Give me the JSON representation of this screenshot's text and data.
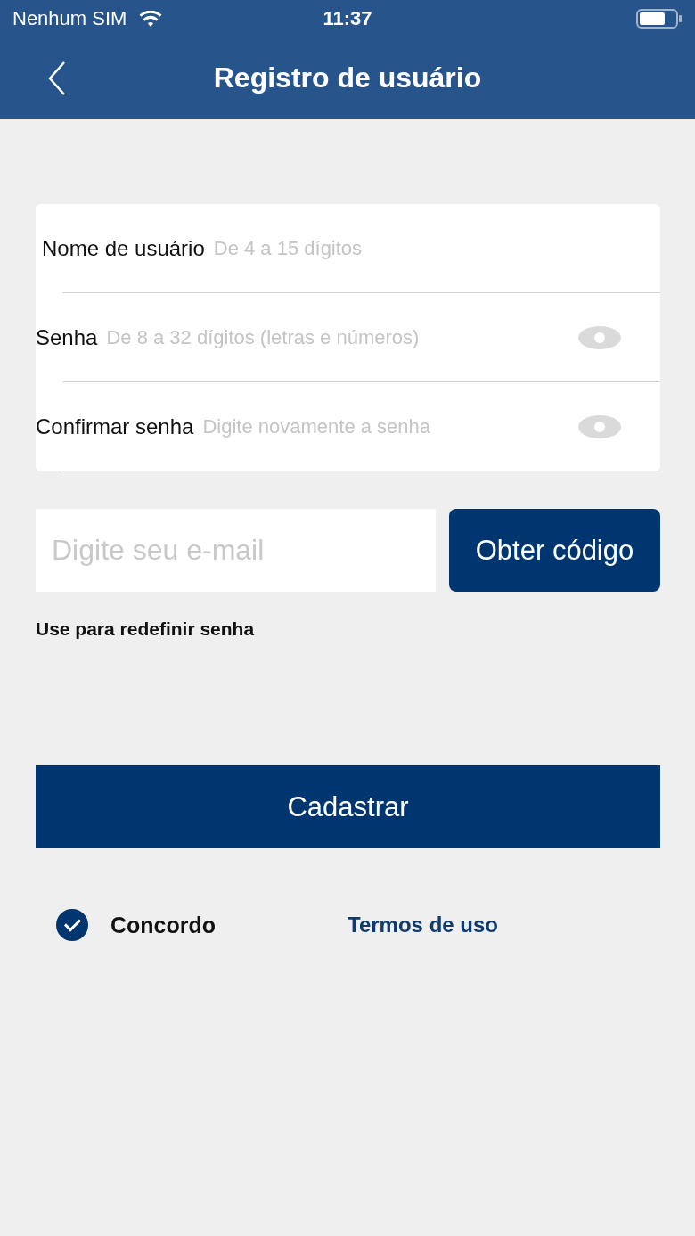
{
  "status_bar": {
    "carrier": "Nenhum SIM",
    "time": "11:37"
  },
  "nav": {
    "title": "Registro de usuário"
  },
  "form_fields": [
    {
      "label": "Nome de usuário",
      "placeholder": "De 4 a 15 dígitos",
      "kind": "text"
    },
    {
      "label": "Senha",
      "placeholder": "De 8 a 32 dígitos (letras e números)",
      "kind": "password"
    },
    {
      "label": "Confirmar senha",
      "placeholder": "Digite novamente a senha",
      "kind": "password"
    }
  ],
  "email": {
    "placeholder": "Digite seu e-mail",
    "button": "Obter código",
    "hint": "Use para redefinir senha"
  },
  "submit_button": "Cadastrar",
  "agreement": {
    "label": "Concordo",
    "checked": true,
    "link": "Termos de uso"
  }
}
